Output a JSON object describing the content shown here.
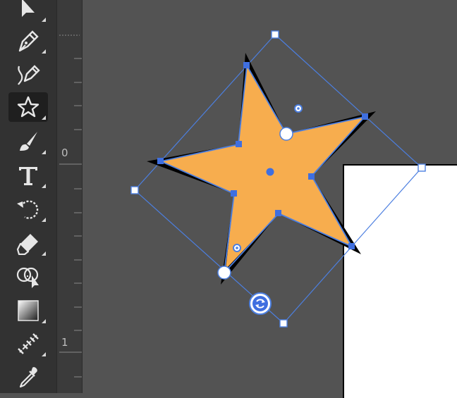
{
  "toolbar": {
    "tools": [
      {
        "name": "direct-selection-tool",
        "icon": "direct-selection-arrow-icon"
      },
      {
        "name": "pen-tool",
        "icon": "pen-nib-icon"
      },
      {
        "name": "curvature-tool",
        "icon": "curvature-pen-icon"
      },
      {
        "name": "star-tool",
        "icon": "star-icon",
        "active": true
      },
      {
        "name": "paintbrush-tool",
        "icon": "paintbrush-icon"
      },
      {
        "name": "type-tool",
        "icon": "type-t-icon"
      },
      {
        "name": "rotate-tool",
        "icon": "rotate-icon"
      },
      {
        "name": "eraser-tool",
        "icon": "eraser-icon"
      },
      {
        "name": "shape-builder-tool",
        "icon": "shape-builder-icon"
      },
      {
        "name": "gradient-tool",
        "icon": "gradient-swatch-icon"
      },
      {
        "name": "blend-tool",
        "icon": "blend-icon"
      },
      {
        "name": "eyedropper-tool",
        "icon": "eyedropper-icon"
      }
    ]
  },
  "ruler": {
    "labels": [
      "0",
      "1"
    ]
  },
  "shape": {
    "type": "star",
    "fill_color": "#F7AD4E",
    "stroke_color": "#000000",
    "selection_color": "#4C7FE0"
  },
  "colors": {
    "toolbar_bg": "#323232",
    "canvas_bg": "#535353",
    "artboard_bg": "#FFFFFF"
  }
}
